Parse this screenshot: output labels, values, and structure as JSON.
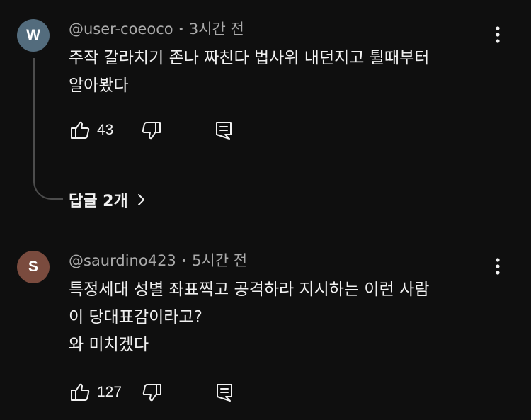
{
  "comments": [
    {
      "avatar_letter": "W",
      "avatar_color": "#536c7d",
      "author": "@user-coeoco",
      "separator": "•",
      "time": "3시간 전",
      "text_lines": [
        "주작 갈라치기 존나 짜친다 법사위 내던지고 튈때부터",
        "알아봤다"
      ],
      "likes": "43",
      "replies_label": "답글 2개"
    },
    {
      "avatar_letter": "S",
      "avatar_color": "#7a4b3e",
      "author": "@saurdino423",
      "separator": "•",
      "time": "5시간 전",
      "text_lines": [
        "특정세대 성별 좌표찍고 공격하라 지시하는 이런 사람",
        "이 당대표감이라고?",
        "와 미치겠다"
      ],
      "likes": "127"
    }
  ],
  "icons": {
    "like": "thumbs-up-icon",
    "dislike": "thumbs-down-icon",
    "reply": "comment-reply-icon",
    "more": "more-vertical-icon",
    "chevron": "chevron-right-icon"
  }
}
